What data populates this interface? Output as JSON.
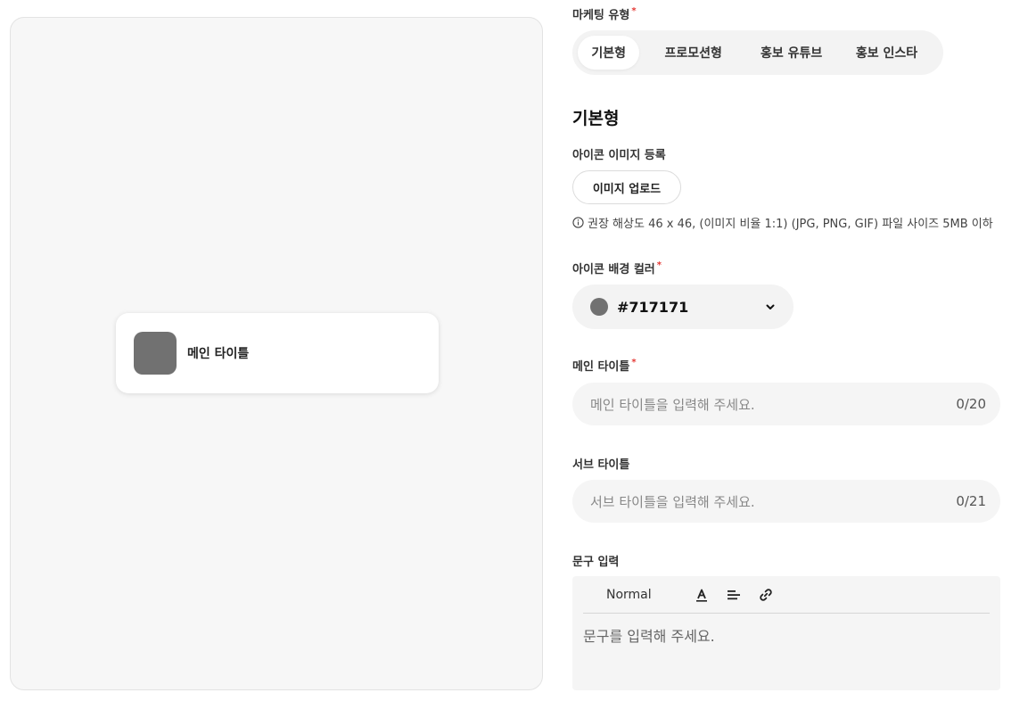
{
  "preview": {
    "card_title": "메인 타이틀",
    "icon_color": "#717171"
  },
  "marketing_type": {
    "label": "마케팅 유형",
    "required_mark": "*",
    "options": [
      "기본형",
      "프로모션형",
      "홍보 유튜브",
      "홍보 인스타"
    ],
    "selected": "기본형"
  },
  "section_title": "기본형",
  "icon_image": {
    "label": "아이콘 이미지 등록",
    "upload_button": "이미지 업로드",
    "hint": "권장 해상도 46 x 46, (이미지 비율 1:1) (JPG, PNG, GIF) 파일 사이즈 5MB 이하"
  },
  "icon_bg_color": {
    "label": "아이콘 배경 컬러",
    "required_mark": "*",
    "value": "#717171"
  },
  "main_title": {
    "label": "메인 타이틀",
    "required_mark": "*",
    "placeholder": "메인 타이틀을 입력해 주세요.",
    "counter": "0/20"
  },
  "sub_title": {
    "label": "서브 타이틀",
    "placeholder": "서브 타이틀을 입력해 주세요.",
    "counter": "0/21"
  },
  "phrase_input": {
    "label": "문구 입력",
    "format_select": "Normal",
    "placeholder": "문구를 입력해 주세요."
  }
}
